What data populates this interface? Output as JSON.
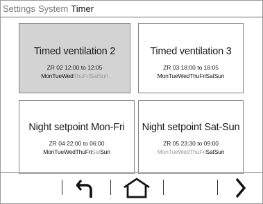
{
  "breadcrumb": {
    "items": [
      "Settings",
      "System"
    ],
    "current": "Timer"
  },
  "tiles": [
    {
      "title": "Timed ventilation 2",
      "schedule": "ZR 02  12:00 to 12:05",
      "selected": true,
      "days": [
        {
          "label": "Mon",
          "active": true
        },
        {
          "label": "Tue",
          "active": true
        },
        {
          "label": "Wed",
          "active": true
        },
        {
          "label": "Thu",
          "active": false
        },
        {
          "label": "Fri",
          "active": false
        },
        {
          "label": "Sat",
          "active": false
        },
        {
          "label": "Sun",
          "active": false
        }
      ]
    },
    {
      "title": "Timed ventilation 3",
      "schedule": "ZR 03  18:00 to 18:05",
      "selected": false,
      "days": [
        {
          "label": "Mon",
          "active": true
        },
        {
          "label": "Tue",
          "active": true
        },
        {
          "label": "Wed",
          "active": true
        },
        {
          "label": "Thu",
          "active": true
        },
        {
          "label": "Fri",
          "active": true
        },
        {
          "label": "Sat",
          "active": true
        },
        {
          "label": "Sun",
          "active": true
        }
      ]
    },
    {
      "title": "Night setpoint Mon-Fri",
      "schedule": "ZR 04  22:00 to 06:00",
      "selected": false,
      "days": [
        {
          "label": "Mon",
          "active": true
        },
        {
          "label": "Tue",
          "active": true
        },
        {
          "label": "Wed",
          "active": true
        },
        {
          "label": "Thu",
          "active": true
        },
        {
          "label": "Fri",
          "active": true
        },
        {
          "label": "Sat",
          "active": false
        },
        {
          "label": "Sun",
          "active": true
        }
      ]
    },
    {
      "title": "Night setpoint Sat-Sun",
      "schedule": "ZR 05  23:30 to 09:00",
      "selected": false,
      "days": [
        {
          "label": "Mon",
          "active": false
        },
        {
          "label": "Tue",
          "active": false
        },
        {
          "label": "Wed",
          "active": false
        },
        {
          "label": "Thu",
          "active": false
        },
        {
          "label": "Fri",
          "active": false
        },
        {
          "label": "Sat",
          "active": true
        },
        {
          "label": "Sun",
          "active": true
        }
      ]
    }
  ],
  "toolbar": {
    "icons": [
      "back-arrow-icon",
      "home-icon",
      "chevron-right-icon"
    ]
  },
  "colors": {
    "selected_tile": "#d3d3d3",
    "inactive_day": "#9a9a9a",
    "active_day": "#111111"
  }
}
